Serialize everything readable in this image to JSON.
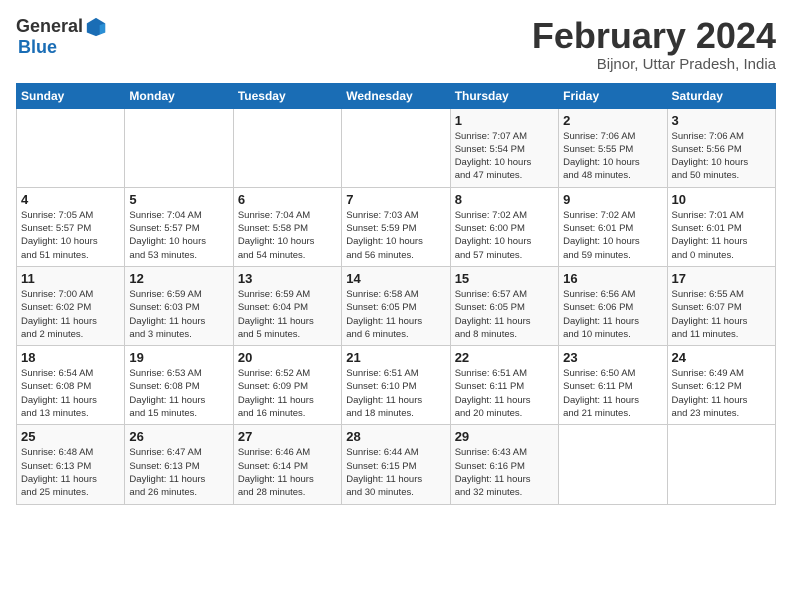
{
  "logo": {
    "general": "General",
    "blue": "Blue"
  },
  "title": "February 2024",
  "subtitle": "Bijnor, Uttar Pradesh, India",
  "weekdays": [
    "Sunday",
    "Monday",
    "Tuesday",
    "Wednesday",
    "Thursday",
    "Friday",
    "Saturday"
  ],
  "weeks": [
    [
      {
        "day": "",
        "info": ""
      },
      {
        "day": "",
        "info": ""
      },
      {
        "day": "",
        "info": ""
      },
      {
        "day": "",
        "info": ""
      },
      {
        "day": "1",
        "info": "Sunrise: 7:07 AM\nSunset: 5:54 PM\nDaylight: 10 hours\nand 47 minutes."
      },
      {
        "day": "2",
        "info": "Sunrise: 7:06 AM\nSunset: 5:55 PM\nDaylight: 10 hours\nand 48 minutes."
      },
      {
        "day": "3",
        "info": "Sunrise: 7:06 AM\nSunset: 5:56 PM\nDaylight: 10 hours\nand 50 minutes."
      }
    ],
    [
      {
        "day": "4",
        "info": "Sunrise: 7:05 AM\nSunset: 5:57 PM\nDaylight: 10 hours\nand 51 minutes."
      },
      {
        "day": "5",
        "info": "Sunrise: 7:04 AM\nSunset: 5:57 PM\nDaylight: 10 hours\nand 53 minutes."
      },
      {
        "day": "6",
        "info": "Sunrise: 7:04 AM\nSunset: 5:58 PM\nDaylight: 10 hours\nand 54 minutes."
      },
      {
        "day": "7",
        "info": "Sunrise: 7:03 AM\nSunset: 5:59 PM\nDaylight: 10 hours\nand 56 minutes."
      },
      {
        "day": "8",
        "info": "Sunrise: 7:02 AM\nSunset: 6:00 PM\nDaylight: 10 hours\nand 57 minutes."
      },
      {
        "day": "9",
        "info": "Sunrise: 7:02 AM\nSunset: 6:01 PM\nDaylight: 10 hours\nand 59 minutes."
      },
      {
        "day": "10",
        "info": "Sunrise: 7:01 AM\nSunset: 6:01 PM\nDaylight: 11 hours\nand 0 minutes."
      }
    ],
    [
      {
        "day": "11",
        "info": "Sunrise: 7:00 AM\nSunset: 6:02 PM\nDaylight: 11 hours\nand 2 minutes."
      },
      {
        "day": "12",
        "info": "Sunrise: 6:59 AM\nSunset: 6:03 PM\nDaylight: 11 hours\nand 3 minutes."
      },
      {
        "day": "13",
        "info": "Sunrise: 6:59 AM\nSunset: 6:04 PM\nDaylight: 11 hours\nand 5 minutes."
      },
      {
        "day": "14",
        "info": "Sunrise: 6:58 AM\nSunset: 6:05 PM\nDaylight: 11 hours\nand 6 minutes."
      },
      {
        "day": "15",
        "info": "Sunrise: 6:57 AM\nSunset: 6:05 PM\nDaylight: 11 hours\nand 8 minutes."
      },
      {
        "day": "16",
        "info": "Sunrise: 6:56 AM\nSunset: 6:06 PM\nDaylight: 11 hours\nand 10 minutes."
      },
      {
        "day": "17",
        "info": "Sunrise: 6:55 AM\nSunset: 6:07 PM\nDaylight: 11 hours\nand 11 minutes."
      }
    ],
    [
      {
        "day": "18",
        "info": "Sunrise: 6:54 AM\nSunset: 6:08 PM\nDaylight: 11 hours\nand 13 minutes."
      },
      {
        "day": "19",
        "info": "Sunrise: 6:53 AM\nSunset: 6:08 PM\nDaylight: 11 hours\nand 15 minutes."
      },
      {
        "day": "20",
        "info": "Sunrise: 6:52 AM\nSunset: 6:09 PM\nDaylight: 11 hours\nand 16 minutes."
      },
      {
        "day": "21",
        "info": "Sunrise: 6:51 AM\nSunset: 6:10 PM\nDaylight: 11 hours\nand 18 minutes."
      },
      {
        "day": "22",
        "info": "Sunrise: 6:51 AM\nSunset: 6:11 PM\nDaylight: 11 hours\nand 20 minutes."
      },
      {
        "day": "23",
        "info": "Sunrise: 6:50 AM\nSunset: 6:11 PM\nDaylight: 11 hours\nand 21 minutes."
      },
      {
        "day": "24",
        "info": "Sunrise: 6:49 AM\nSunset: 6:12 PM\nDaylight: 11 hours\nand 23 minutes."
      }
    ],
    [
      {
        "day": "25",
        "info": "Sunrise: 6:48 AM\nSunset: 6:13 PM\nDaylight: 11 hours\nand 25 minutes."
      },
      {
        "day": "26",
        "info": "Sunrise: 6:47 AM\nSunset: 6:13 PM\nDaylight: 11 hours\nand 26 minutes."
      },
      {
        "day": "27",
        "info": "Sunrise: 6:46 AM\nSunset: 6:14 PM\nDaylight: 11 hours\nand 28 minutes."
      },
      {
        "day": "28",
        "info": "Sunrise: 6:44 AM\nSunset: 6:15 PM\nDaylight: 11 hours\nand 30 minutes."
      },
      {
        "day": "29",
        "info": "Sunrise: 6:43 AM\nSunset: 6:16 PM\nDaylight: 11 hours\nand 32 minutes."
      },
      {
        "day": "",
        "info": ""
      },
      {
        "day": "",
        "info": ""
      }
    ]
  ]
}
